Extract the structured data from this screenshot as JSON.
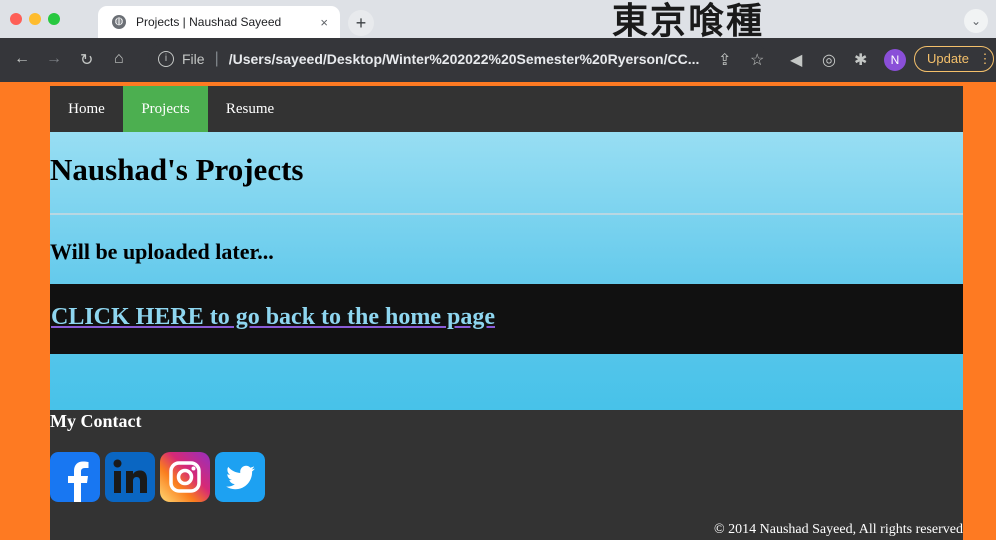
{
  "browser": {
    "tab_title": "Projects | Naushad Sayeed",
    "tab_close": "×",
    "new_tab": "+",
    "extension_banner": "東京喰種",
    "url_scheme_label": "File",
    "url": "/Users/sayeed/Desktop/Winter%202022%20Semester%20Ryerson/CC...",
    "profile_initial": "N",
    "update_label": "Update",
    "menu_glyph": "⋮"
  },
  "nav": {
    "items": [
      {
        "label": "Home"
      },
      {
        "label": "Projects"
      },
      {
        "label": "Resume"
      }
    ],
    "active": "Projects"
  },
  "main": {
    "title": "Naushad's Projects",
    "subtitle": "Will be uploaded later...",
    "back_link": "CLICK HERE to go back to the home page"
  },
  "footer": {
    "contact_heading": "My Contact",
    "social": [
      {
        "icon": "facebook-icon"
      },
      {
        "icon": "linkedin-icon"
      },
      {
        "icon": "instagram-icon"
      },
      {
        "icon": "twitter-icon"
      }
    ],
    "copyright": "© 2014 Naushad Sayeed, All rights reserved"
  },
  "colors": {
    "page_background": "#fe7a22",
    "nav_background": "#333333",
    "active_nav": "#4caf50",
    "link_bar": "#111111",
    "link_text": "#8ed6f0"
  }
}
